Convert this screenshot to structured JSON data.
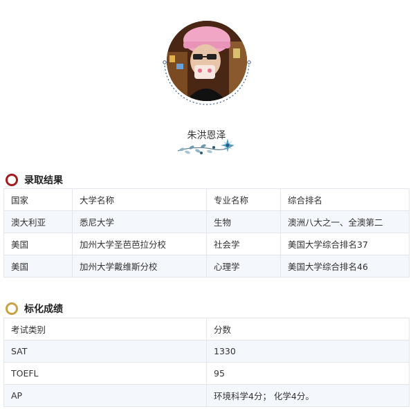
{
  "profile": {
    "name": "朱洪恩泽",
    "avatar_icon": "student-photo"
  },
  "colors": {
    "section1_ring": "#a41c1c",
    "section2_ring": "#c9a244",
    "row_alt_bg": "#f4f7fb",
    "border": "#e2e6ec"
  },
  "admission": {
    "title": "录取结果",
    "headers": [
      "国家",
      "大学名称",
      "专业名称",
      "综合排名"
    ],
    "rows": [
      [
        "澳大利亚",
        "悉尼大学",
        "生物",
        "澳洲八大之一、全澳第二"
      ],
      [
        "美国",
        "加州大学圣芭芭拉分校",
        "社会学",
        "美国大学综合排名37"
      ],
      [
        "美国",
        "加州大学戴维斯分校",
        "心理学",
        "美国大学综合排名46"
      ]
    ]
  },
  "scores": {
    "title": "标化成绩",
    "headers": [
      "考试类别",
      "分数"
    ],
    "rows": [
      [
        "SAT",
        "1330"
      ],
      [
        "TOEFL",
        "95"
      ],
      [
        "AP",
        "环境科学4分； 化学4分。"
      ]
    ]
  }
}
